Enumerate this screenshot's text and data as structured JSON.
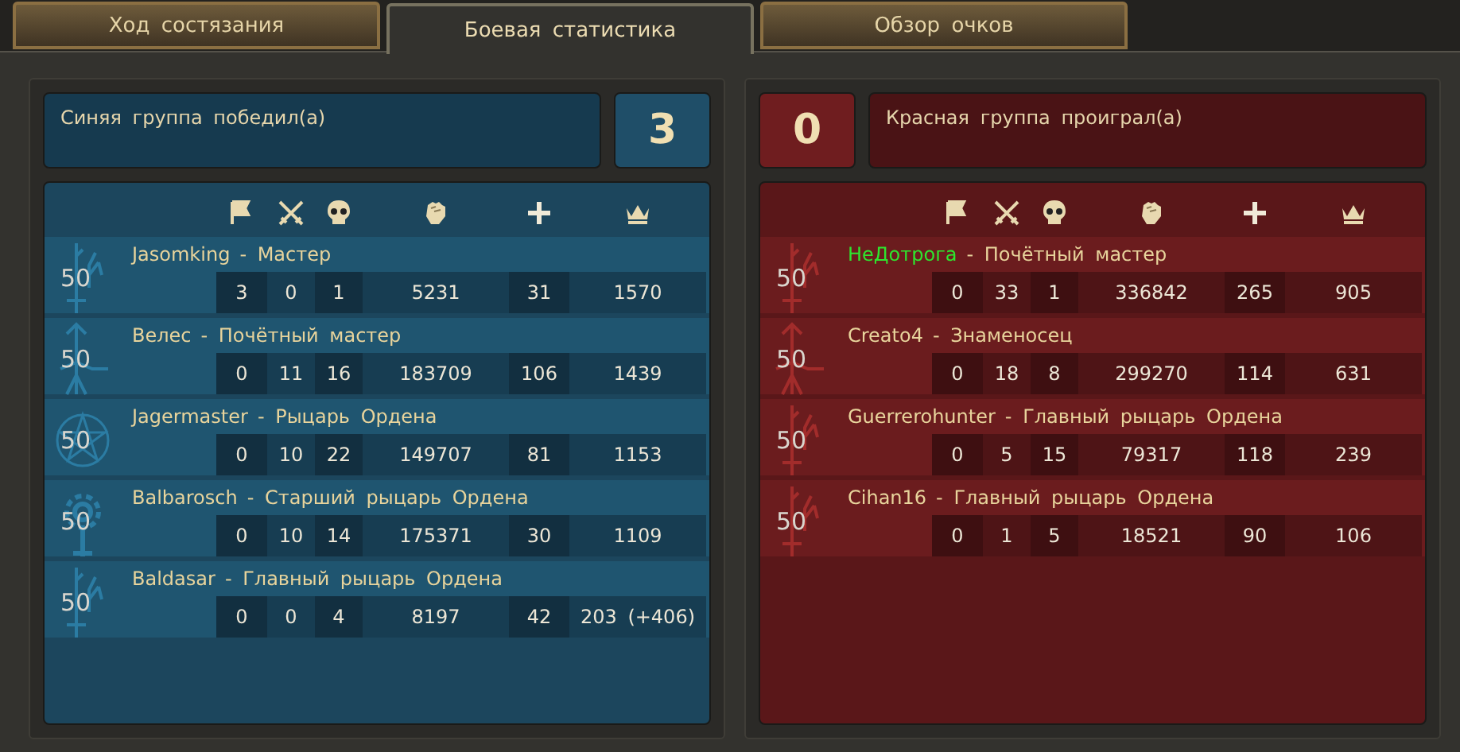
{
  "tabs": [
    {
      "label": "Ход состязания",
      "selected": false
    },
    {
      "label": "Боевая статистика",
      "selected": true
    },
    {
      "label": "Обзор очков",
      "selected": false
    }
  ],
  "teams": [
    {
      "kind": "blue",
      "result": "Синяя группа победил(а)",
      "score": "3",
      "players": [
        {
          "kind": "sword",
          "level": "50",
          "name": "Jasomking",
          "highlighted": false,
          "rank": "- Мастер",
          "stats": [
            "3",
            "0",
            "1",
            "5231",
            "31",
            "1570"
          ]
        },
        {
          "kind": "roots",
          "level": "50",
          "name": "Велес",
          "highlighted": false,
          "rank": "- Почётный мастер",
          "stats": [
            "0",
            "11",
            "16",
            "183709",
            "106",
            "1439"
          ]
        },
        {
          "kind": "pentagram",
          "level": "50",
          "name": "Jagermaster",
          "highlighted": false,
          "rank": "- Рыцарь Ордена",
          "stats": [
            "0",
            "10",
            "22",
            "149707",
            "81",
            "1153"
          ]
        },
        {
          "kind": "gear",
          "level": "50",
          "name": "Balbarosch",
          "highlighted": false,
          "rank": "- Старший рыцарь Ордена",
          "stats": [
            "0",
            "10",
            "14",
            "175371",
            "30",
            "1109"
          ]
        },
        {
          "kind": "sword",
          "level": "50",
          "name": "Baldasar",
          "highlighted": false,
          "rank": "- Главный рыцарь Ордена",
          "stats": [
            "0",
            "0",
            "4",
            "8197",
            "42",
            "203 (+406)"
          ]
        }
      ]
    },
    {
      "kind": "red",
      "result": "Красная группа проиграл(а)",
      "score": "0",
      "players": [
        {
          "kind": "sword",
          "level": "50",
          "name": "НеДотрога",
          "highlighted": true,
          "rank": "- Почётный мастер",
          "stats": [
            "0",
            "33",
            "1",
            "336842",
            "265",
            "905"
          ]
        },
        {
          "kind": "roots",
          "level": "50",
          "name": "Creato4",
          "highlighted": false,
          "rank": "- Знаменосец",
          "stats": [
            "0",
            "18",
            "8",
            "299270",
            "114",
            "631"
          ]
        },
        {
          "kind": "sword",
          "level": "50",
          "name": "Guerrerohunter",
          "highlighted": false,
          "rank": "- Главный рыцарь Ордена",
          "stats": [
            "0",
            "5",
            "15",
            "79317",
            "118",
            "239"
          ]
        },
        {
          "kind": "sword",
          "level": "50",
          "name": "Cihan16",
          "highlighted": false,
          "rank": "- Главный рыцарь Ордена",
          "stats": [
            "0",
            "1",
            "5",
            "18521",
            "90",
            "106"
          ]
        }
      ]
    }
  ]
}
